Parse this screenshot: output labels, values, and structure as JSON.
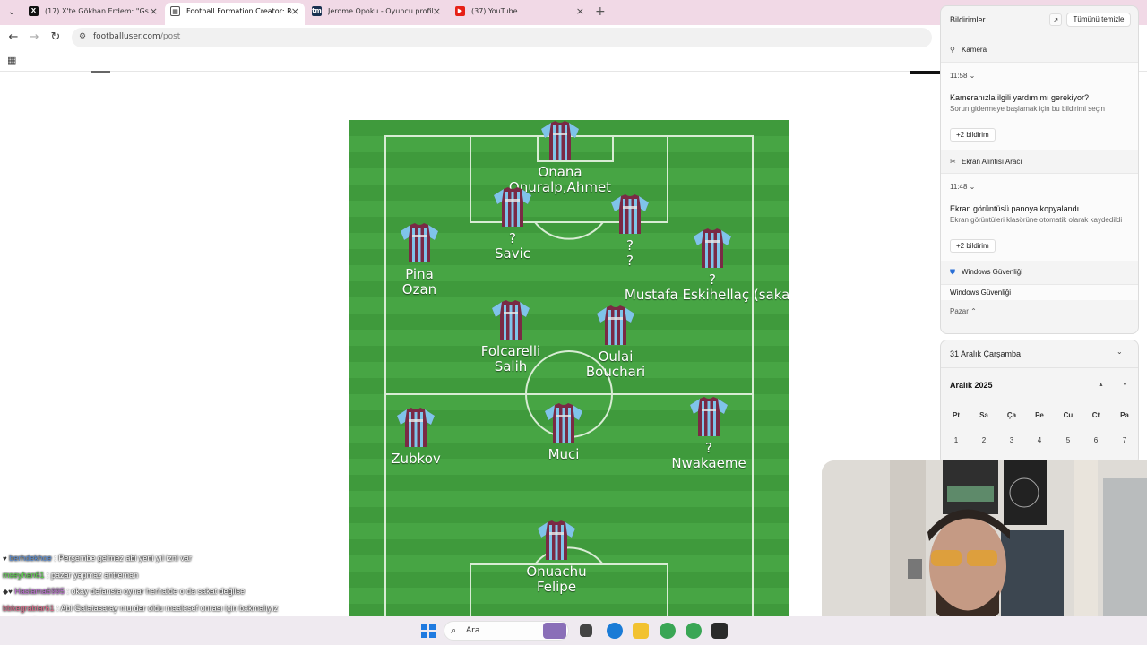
{
  "browser": {
    "tabs": [
      {
        "title": "(17) X'te Gökhan Erdem: \"Gs m...",
        "icon": "x-logo-icon"
      },
      {
        "title": "Football Formation Creator: Re...",
        "icon": "formation-icon",
        "active": true
      },
      {
        "title": "Jerome Opoku - Oyuncu profili",
        "icon": "transfermarkt-icon"
      },
      {
        "title": "(37) YouTube",
        "icon": "youtube-icon"
      }
    ],
    "url_host": "footballuser.com",
    "url_path": "/post"
  },
  "formation": {
    "players": [
      {
        "lines": [
          "Onana",
          "Onuralp,Ahmet"
        ]
      },
      {
        "lines": [
          "?",
          "Savic"
        ]
      },
      {
        "lines": [
          "?",
          "?"
        ]
      },
      {
        "lines": [
          "Pina",
          "Ozan"
        ]
      },
      {
        "lines": [
          "?",
          "Mustafa Eskihellaç (sakat)"
        ]
      },
      {
        "lines": [
          "Folcarelli",
          "Salih"
        ]
      },
      {
        "lines": [
          "Oulai",
          "Bouchari"
        ]
      },
      {
        "lines": [
          "Zubkov"
        ]
      },
      {
        "lines": [
          "Muci"
        ]
      },
      {
        "lines": [
          "?",
          "Nwakaeme"
        ]
      },
      {
        "lines": [
          "Onuachu",
          "Felipe"
        ]
      }
    ]
  },
  "chat": {
    "messages": [
      {
        "user": "berhdekhoe",
        "text": ": Perşembe gelmez abi yeni yıl izni var"
      },
      {
        "user": "mseyhan61",
        "text": ": pazar yapmaz antreman"
      },
      {
        "user": "Haslama6995",
        "text": ": okay defansta oynar herhalde o da sakat değilse"
      },
      {
        "user": "bbkegrabiar61",
        "text": ": Abi Galatasaray murdar oldu maalesef onrası için bakmalıyız"
      }
    ],
    "overflow_line": "maalesef",
    "cut_text": "lm"
  },
  "notifications": {
    "title": "Bildirimler",
    "clear_all": "Tümünü temizle",
    "groups": [
      {
        "app": "Kamera",
        "time": "11:58",
        "title": "Kameranızla ilgili yardım mı gerekiyor?",
        "body": "Sorun gidermeye başlamak için bu bildirimi seçin",
        "more": "+2 bildirim"
      },
      {
        "app": "Ekran Alıntısı Aracı",
        "time": "11:48",
        "title": "Ekran görüntüsü panoya kopyalandı",
        "body": "Ekran görüntüleri klasörüne otomatik olarak kaydedildi",
        "more": "+2 bildirim"
      },
      {
        "app": "Windows Güvenliği",
        "title": "Windows Güvenliği"
      }
    ],
    "group_label": "Pazar"
  },
  "calendar": {
    "date_header": "31 Aralık Çarşamba",
    "month": "Aralık 2025",
    "weekdays": [
      "Pt",
      "Sa",
      "Ça",
      "Pe",
      "Cu",
      "Ct",
      "Pa"
    ],
    "days": [
      "1",
      "2",
      "3",
      "4",
      "5",
      "6",
      "7"
    ]
  },
  "taskbar": {
    "search_label": "Ara"
  },
  "colors": {
    "pitch": "#47a544",
    "shirt_claret": "#7a2a45",
    "shirt_blue": "#7fc4ea"
  }
}
